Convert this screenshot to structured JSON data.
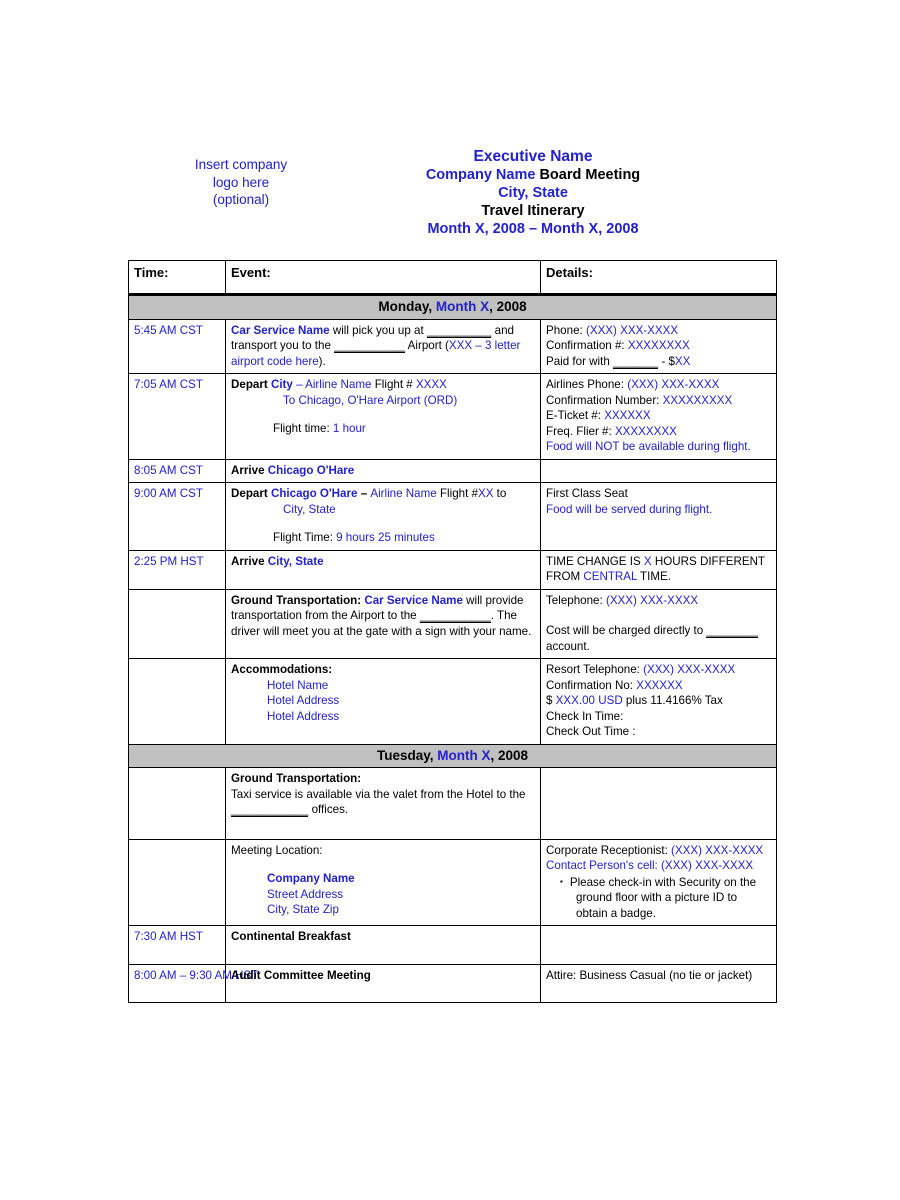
{
  "document": {
    "logo_placeholder": [
      "Insert company",
      "logo here",
      "(optional)"
    ],
    "title_lines": {
      "executive": "Executive Name",
      "company": "Company Name",
      "meeting": "Board Meeting",
      "city_state": "City, State",
      "doc_type": "Travel Itinerary",
      "dates": "Month X, 2008 – Month X, 2008"
    }
  },
  "colors": {
    "accent_blue": "#2222cc",
    "day_band_gray": "#c0c0c0",
    "text_black": "#000000"
  },
  "table": {
    "columns": [
      "Time:",
      "Event:",
      "Details:"
    ],
    "days": [
      {
        "label_prefix": "Monday, ",
        "label_month": "Month X",
        "label_suffix": ", 2008",
        "rows": [
          {
            "time": "5:45 AM CST",
            "event_lines": [
              "Car Service Name will pick you up at __________ and transport you to the ___________ Airport (XXX – 3 letter airport code here)."
            ],
            "detail_lines": [
              "Phone: (XXX) XXX-XXXX",
              "Confirmation #: XXXXXXXX",
              "Paid for with _______ - $XX"
            ]
          },
          {
            "time": "7:05 AM CST",
            "event_lines": [
              "Depart City – Airline Name Flight # XXXX",
              "To Chicago, O'Hare Airport (ORD)",
              "Flight time: 1 hour"
            ],
            "detail_lines": [
              "Airlines Phone: (XXX) XXX-XXXX",
              "Confirmation Number: XXXXXXXXX",
              "E-Ticket #: XXXXXX",
              "Freq. Flier #: XXXXXXXX",
              "Food will NOT be available during flight."
            ]
          },
          {
            "time": "8:05 AM CST",
            "event_lines": [
              "Arrive Chicago O'Hare"
            ],
            "detail_lines": []
          },
          {
            "time": "9:00 AM CST",
            "event_lines": [
              "Depart Chicago O'Hare – Airline Name Flight #XX to City, State",
              "Flight Time: 9 hours 25 minutes"
            ],
            "detail_lines": [
              "First Class Seat",
              "Food will be served during flight."
            ]
          },
          {
            "time": "2:25 PM HST",
            "event_lines": [
              "Arrive City, State"
            ],
            "detail_lines": [
              "TIME CHANGE IS X HOURS DIFFERENT FROM CENTRAL TIME."
            ]
          },
          {
            "time": "",
            "event_lines": [
              "Ground Transportation: Car Service Name will provide transportation from the Airport to the ___________.  The driver will meet you at the gate with a sign with your name."
            ],
            "detail_lines": [
              "Telephone:  (XXX) XXX-XXXX",
              "Cost will be charged directly to ________ account."
            ]
          },
          {
            "time": "",
            "event_lines": [
              "Accommodations:",
              "Hotel Name",
              "Hotel Address",
              "Hotel Address"
            ],
            "detail_lines": [
              "Resort Telephone:  (XXX) XXX-XXXX",
              "Confirmation No:  XXXXXX",
              "$ XXX.00 USD plus 11.4166% Tax",
              "Check In Time:",
              "Check Out Time :"
            ]
          }
        ]
      },
      {
        "label_prefix": "Tuesday, ",
        "label_month": "Month X",
        "label_suffix": ", 2008",
        "rows": [
          {
            "time": "",
            "event_lines": [
              "Ground Transportation:",
              "Taxi service is available via the valet from the Hotel to the ____________ offices."
            ],
            "detail_lines": []
          },
          {
            "time": "",
            "event_lines": [
              "Meeting Location:",
              "Company Name",
              "Street Address",
              "City, State Zip"
            ],
            "detail_lines": [
              "Corporate Receptionist: (XXX) XXX-XXXX",
              "Contact Person's cell:  (XXX) XXX-XXXX",
              "Please check-in with Security on the ground floor with a picture ID to obtain a badge."
            ]
          },
          {
            "time": "7:30 AM HST",
            "event_lines": [
              "Continental Breakfast"
            ],
            "detail_lines": []
          },
          {
            "time": "8:00 AM – 9:30 AM HST",
            "event_lines": [
              "Audit Committee Meeting"
            ],
            "detail_lines": [
              "Attire: Business Casual (no tie or jacket)"
            ]
          }
        ]
      }
    ]
  },
  "fragments": {
    "car_service_name": "Car Service Name",
    "will_pick_you_up_at": " will pick you up at ",
    "blank_10": "__________",
    "and_transport": " and transport you to the ",
    "blank_11": "___________",
    "airport_word": " Airport (",
    "xxx_3letter": "XXX – 3 letter airport code here",
    "close_paren": ").",
    "depart": "Depart ",
    "city": "City",
    "dash_airline": " – Airline Name",
    "flight_hash": " Flight # ",
    "xxxx": "XXXX",
    "to_chicago": "To Chicago, O'Hare Airport (ORD)",
    "flight_time_label": "Flight time: ",
    "one_hour": "1 hour",
    "arrive": "Arrive ",
    "chicago_ohare": "Chicago O'Hare",
    "depart_ohare_dash": " – ",
    "airline_name": "Airline Name",
    "flight_hash_xx": " Flight #",
    "xx": "XX",
    "to_word": " to",
    "city_state": "City, State",
    "flight_time_label2": "Flight Time:  ",
    "nine_hours": "9 hours 25 minutes",
    "ground_transportation": "Ground Transportation:",
    "ground_transportation_sp": "Ground Transportation:  ",
    "will_provide": " will provide transportation from the Airport to the ",
    "blank_12": "___________",
    "period_driver": ".  The driver will meet you at the gate with a sign with your name.",
    "accommodations": "Accommodations:",
    "hotel_name": "Hotel Name",
    "hotel_address": "Hotel Address",
    "phone_label": "Phone: ",
    "phone_value": "(XXX) XXX-XXXX",
    "confirmation_hash_label": "Confirmation #: ",
    "confirmation_hash_value": "XXXXXXXX",
    "paid_for_with": "Paid for with ",
    "blank_7": "_______",
    "dash_dollar": " - $",
    "xx_money": "XX",
    "airlines_phone_label": "Airlines Phone: ",
    "confirmation_number_label": "Confirmation Number: ",
    "confirmation_number_value": "XXXXXXXXX",
    "eticket_label": "E-Ticket #: ",
    "eticket_value": "XXXXXX",
    "freq_flier_label": "Freq. Flier #: ",
    "freq_flier_value": "XXXXXXXX",
    "food_not_available": "Food will NOT be available during flight.",
    "first_class_seat": "First Class Seat",
    "food_served": "Food will be served during flight.",
    "time_change_1": "TIME CHANGE IS ",
    "time_change_x": "X",
    "time_change_2": " HOURS DIFFERENT FROM ",
    "time_change_central": "CENTRAL",
    "time_change_3": " TIME.",
    "telephone_label": "Telephone:  ",
    "cost_charged": "Cost will be charged directly to ",
    "blank_8": "________",
    "account_word": " account.",
    "resort_telephone_label": "Resort Telephone:  ",
    "confirmation_no_label": "Confirmation No:  ",
    "confirmation_no_value": "XXXXXX",
    "dollar_sign": "$ ",
    "usd_amount": "XXX.00 USD",
    "plus_tax": " plus 11.4166% Tax",
    "check_in_time": "Check In Time:",
    "check_out_time": "Check Out Time :",
    "taxi_service_1": "Taxi service is available via the valet from the Hotel to the ",
    "blank_13": "____________",
    "offices_word": " offices.",
    "meeting_location": "Meeting Location:",
    "company_name": "Company Name",
    "street_address": "Street Address",
    "city_state_zip": "City, State Zip",
    "corporate_receptionist_label": "Corporate Receptionist: ",
    "contact_cell_label": "Contact Person's cell:  ",
    "contact_cell_value": "(XXX) XXX-XXXX",
    "bullet_glyph": "▪",
    "security_text": "Please check-in with Security on the ground floor with a picture ID to obtain a badge."
  }
}
